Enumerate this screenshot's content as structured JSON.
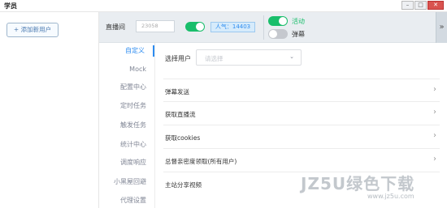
{
  "window": {
    "title": "学员",
    "min": "–",
    "max": "□",
    "close": "✕"
  },
  "users": {
    "add_button": "+ 添加新用户"
  },
  "topbar": {
    "room_label": "直播间",
    "room_placeholder": "23058",
    "room_toggle_on": true,
    "popularity": "人气：14403",
    "activity_label": "活动",
    "activity_on": true,
    "danmaku_label": "弹幕",
    "danmaku_on": false,
    "collapse": "»"
  },
  "menu": {
    "items": [
      {
        "label": "自定义",
        "active": true
      },
      {
        "label": "Mock"
      },
      {
        "label": "配置中心"
      },
      {
        "label": "定时任务"
      },
      {
        "label": "触发任务"
      },
      {
        "label": "统计中心"
      },
      {
        "label": "调度响应"
      },
      {
        "label": "小黑屋回避"
      },
      {
        "label": "代理设置"
      }
    ]
  },
  "content": {
    "select_label": "选择用户",
    "select_placeholder": "请选择",
    "rows": [
      {
        "label": "弹幕发送",
        "arrow": "›"
      },
      {
        "label": "获取直播流",
        "arrow": "›"
      },
      {
        "label": "获取cookies",
        "arrow": "›"
      },
      {
        "label": "总督亲密度领取(所有用户)",
        "arrow": "›"
      },
      {
        "label": "主站分享视频",
        "arrow": ""
      }
    ]
  },
  "watermark": {
    "main": "JZ5U绿色下载",
    "sub": "www.jz5u.com"
  },
  "colors": {
    "accent": "#2d8cf0",
    "toggle_on": "#19be6b",
    "toggle_off": "#c5c8ce"
  }
}
